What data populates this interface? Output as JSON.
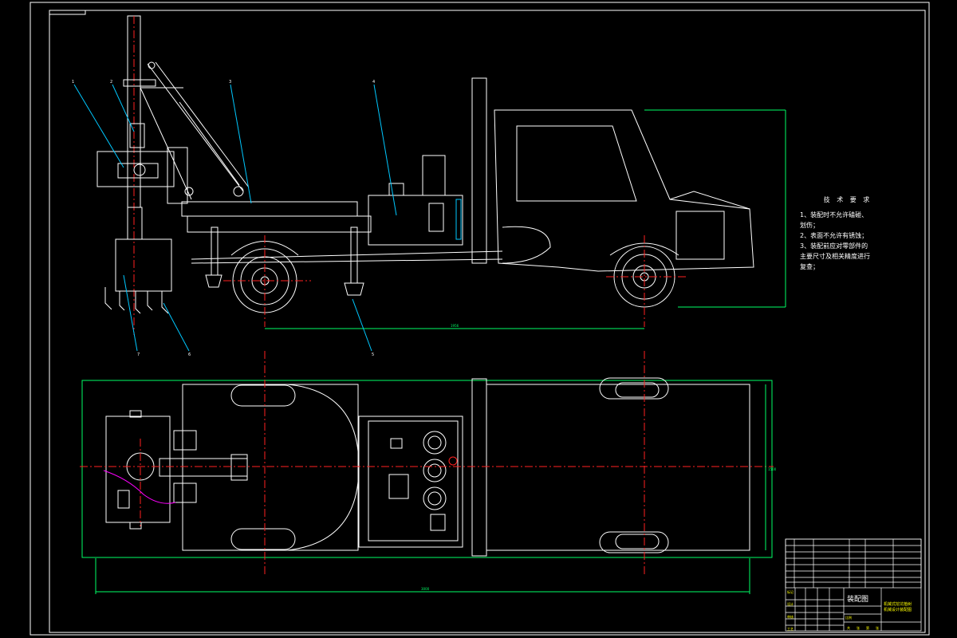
{
  "colors": {
    "background": "#000000",
    "geometry": "#ffffff",
    "dimension": "#00ff66",
    "centerline": "#ff2020",
    "hidden": "#ff00ff",
    "hatch": "#00c8ff",
    "titleblock_text": "#ffff00"
  },
  "balloons": [
    "1",
    "2",
    "3",
    "4",
    "5",
    "6",
    "7"
  ],
  "dimensions": {
    "wheelbase": "1956",
    "overall_length": "3000",
    "overall_width": "1500"
  },
  "tech_notes": {
    "title": "技 术 要 求",
    "lines": [
      "1、装配时不允许磕碰、",
      "划伤；",
      "2、表面不允许有锈蚀；",
      "3、装配前应对零部件的",
      "主要尺寸及相关精度进行",
      "复查；"
    ]
  },
  "title_block": {
    "drawing_name": "装配图",
    "subtitle_lines": [
      "机械式挖坑植树",
      "机械设计装配图"
    ],
    "row_labels": [
      "标记",
      "设计",
      "审核",
      "工艺"
    ],
    "footer": [
      "共",
      "张",
      "第",
      "张"
    ],
    "scale_label": "比例"
  }
}
